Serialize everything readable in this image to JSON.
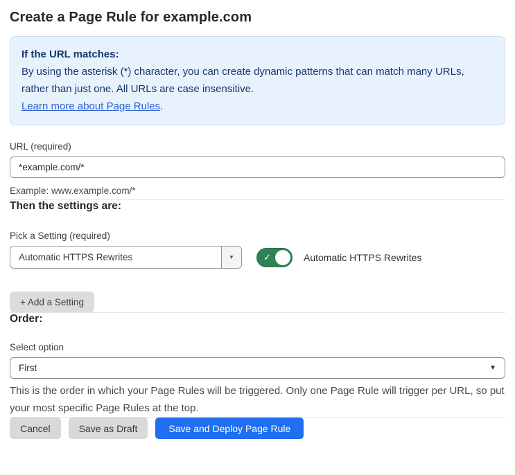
{
  "page": {
    "title": "Create a Page Rule for example.com"
  },
  "info_box": {
    "heading": "If the URL matches:",
    "body": "By using the asterisk (*) character, you can create dynamic patterns that can match many URLs, rather than just one. All URLs are case insensitive.",
    "link_label": "Learn more about Page Rules",
    "link_suffix": "."
  },
  "url_field": {
    "label": "URL (required)",
    "value": "*example.com/*",
    "helper": "Example: www.example.com/*"
  },
  "settings_section": {
    "heading": "Then the settings are:",
    "picker_label": "Pick a Setting (required)",
    "picker_value": "Automatic HTTPS Rewrites",
    "picker_caret": "▼",
    "toggle_state": "on",
    "toggle_check": "✓",
    "toggle_label": "Automatic HTTPS Rewrites",
    "add_button_label": "+ Add a Setting"
  },
  "order_section": {
    "heading": "Order:",
    "select_label": "Select option",
    "select_value": "First",
    "select_caret": "▼",
    "helper": "This is the order in which your Page Rules will be triggered. Only one Page Rule will trigger per URL, so put your most specific Page Rules at the top."
  },
  "actions": {
    "cancel_label": "Cancel",
    "save_draft_label": "Save as Draft",
    "save_deploy_label": "Save and Deploy Page Rule"
  },
  "colors": {
    "info_bg": "#e8f2fc",
    "info_border": "#c5daf1",
    "info_text": "#17356f",
    "link_blue": "#2b5fd3",
    "toggle_green": "#2f8352",
    "primary_blue": "#1f6ff0",
    "secondary_gray": "#d9d9d9"
  }
}
